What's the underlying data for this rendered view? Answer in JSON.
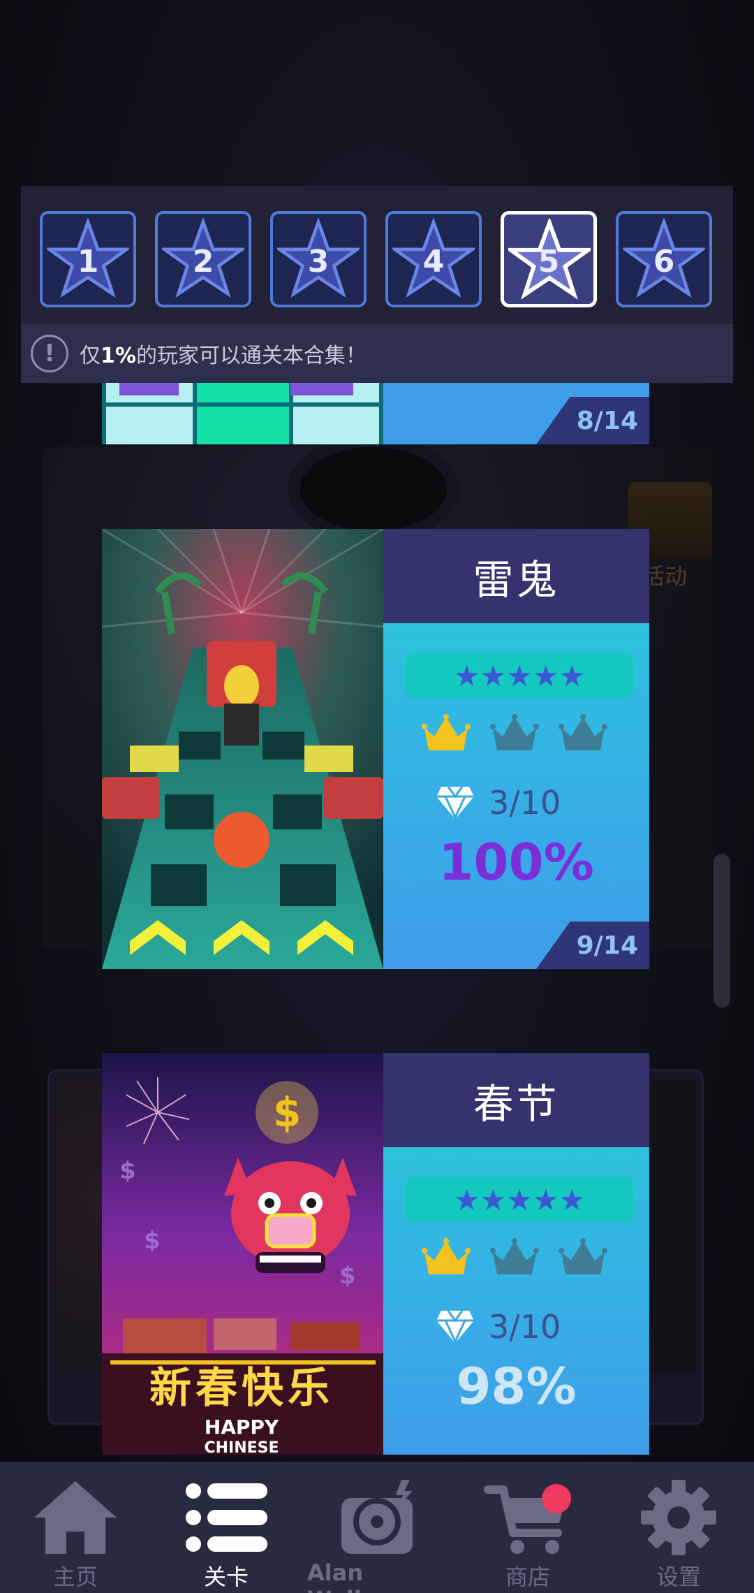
{
  "level_selector": {
    "levels": [
      {
        "number": "1",
        "selected": false
      },
      {
        "number": "2",
        "selected": false
      },
      {
        "number": "3",
        "selected": false
      },
      {
        "number": "4",
        "selected": false
      },
      {
        "number": "5",
        "selected": true
      },
      {
        "number": "6",
        "selected": false
      }
    ],
    "hint": {
      "icon": "!",
      "prefix": "仅",
      "highlight": "1%",
      "suffix": "的玩家可以通关本合集！"
    }
  },
  "background": {
    "side_label": "活动"
  },
  "cards": [
    {
      "title": "",
      "progress": "8/14"
    },
    {
      "title": "雷鬼",
      "stars": "★★★★★",
      "crowns_earned": 1,
      "crowns_total": 3,
      "diamonds": "3/10",
      "percent": "100%",
      "progress": "9/14",
      "percent_color": "#7b2fd8"
    },
    {
      "title": "春节",
      "stars": "★★★★★",
      "crowns_earned": 1,
      "crowns_total": 3,
      "diamonds": "3/10",
      "percent": "98%",
      "percent_color": "#cfe6f7",
      "art_text_cn": "新春快乐",
      "art_text_en": "HAPPY",
      "art_text_en2": "CHINESE",
      "art_symbol": "$"
    }
  ],
  "bottom_nav": [
    {
      "label": "主页",
      "icon": "home-icon",
      "active": false
    },
    {
      "label": "关卡",
      "icon": "list-icon",
      "active": true
    },
    {
      "label": "Alan Walker",
      "icon": "vinyl-icon",
      "active": false
    },
    {
      "label": "商店",
      "icon": "cart-icon",
      "active": false,
      "badge": true
    },
    {
      "label": "设置",
      "icon": "gear-icon",
      "active": false
    }
  ],
  "colors": {
    "accent_blue": "#4e7bd9",
    "crown_gold": "#f4c21f",
    "crown_dim": "#3e7d95",
    "badge_red": "#f03a5f"
  }
}
